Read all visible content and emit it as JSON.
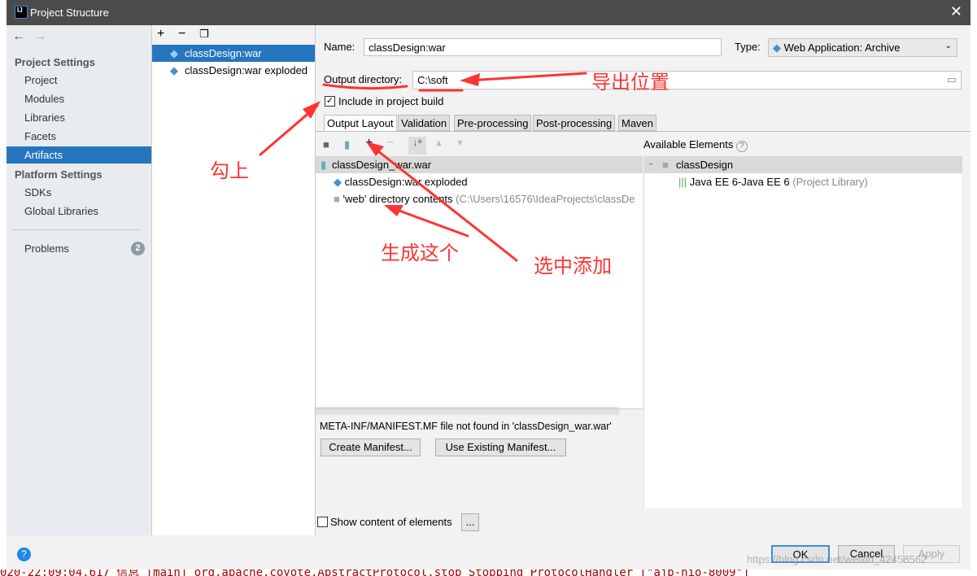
{
  "window": {
    "title": "Project Structure"
  },
  "sidebar": {
    "sections": [
      {
        "label": "Project Settings",
        "items": [
          "Project",
          "Modules",
          "Libraries",
          "Facets",
          "Artifacts"
        ]
      },
      {
        "label": "Platform Settings",
        "items": [
          "SDKs",
          "Global Libraries"
        ]
      }
    ],
    "selected": "Artifacts",
    "problems_label": "Problems",
    "problems_count": "2"
  },
  "artifacts": {
    "items": [
      "classDesign:war",
      "classDesign:war exploded"
    ],
    "selected": "classDesign:war"
  },
  "form": {
    "name_label": "Name:",
    "name_value": "classDesign:war",
    "type_label": "Type:",
    "type_value": "Web Application: Archive",
    "output_label": "Output directory:",
    "output_value": "C:\\soft",
    "include_label": "Include in project build",
    "include_checked": true
  },
  "tabs": [
    "Output Layout",
    "Validation",
    "Pre-processing",
    "Post-processing",
    "Maven"
  ],
  "layout": {
    "root": "classDesign_war.war",
    "children": [
      {
        "label": "classDesign:war exploded",
        "detail": ""
      },
      {
        "label": "'web' directory contents",
        "detail": "(C:\\Users\\16576\\IdeaProjects\\classDe"
      }
    ]
  },
  "available": {
    "title": "Available Elements",
    "help": "?",
    "module": "classDesign",
    "library": "Java EE 6-Java EE 6",
    "library_detail": "(Project Library)"
  },
  "manifest": {
    "message": "META-INF/MANIFEST.MF file not found in 'classDesign_war.war'",
    "create": "Create Manifest...",
    "use_existing": "Use Existing Manifest..."
  },
  "show_content": {
    "label": "Show content of elements",
    "more": "..."
  },
  "footer": {
    "ok": "OK",
    "cancel": "Cancel",
    "apply": "Apply",
    "help": "?"
  },
  "annotations": {
    "export_location": "导出位置",
    "check": "勾上",
    "generate": "生成这个",
    "select_add": "选中添加",
    "color": "#ff3333"
  },
  "watermark": "https://blog.csdn.net/weixin_42458562",
  "console": "020-22:09:04.617 信息 [main] org.apache.coyote.AbstractProtocol.stop Stopping ProtocolHandler [\"ajp-nio-8009\"]"
}
